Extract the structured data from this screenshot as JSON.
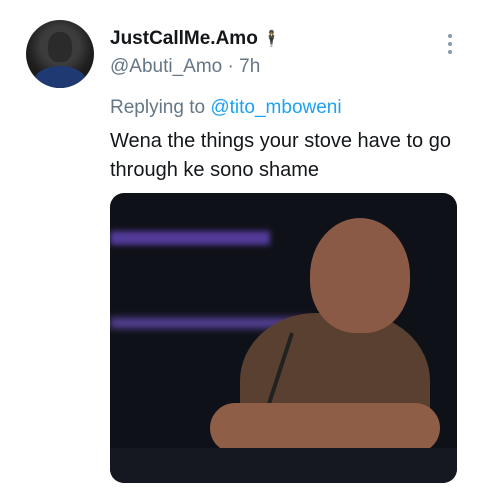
{
  "user": {
    "display_name": "JustCallMe.Amo",
    "name_emoji": "🕴",
    "handle": "@Abuti_Amo",
    "separator": "·",
    "time": "7h"
  },
  "reply": {
    "prefix": "Replying to ",
    "mention": "@tito_mboweni"
  },
  "tweet": {
    "text": "Wena the things your stove have to go through ke sono shame"
  },
  "colors": {
    "link": "#1da1f2",
    "secondary_text": "#657786"
  },
  "icons": {
    "more": "vertical-ellipsis-icon"
  }
}
